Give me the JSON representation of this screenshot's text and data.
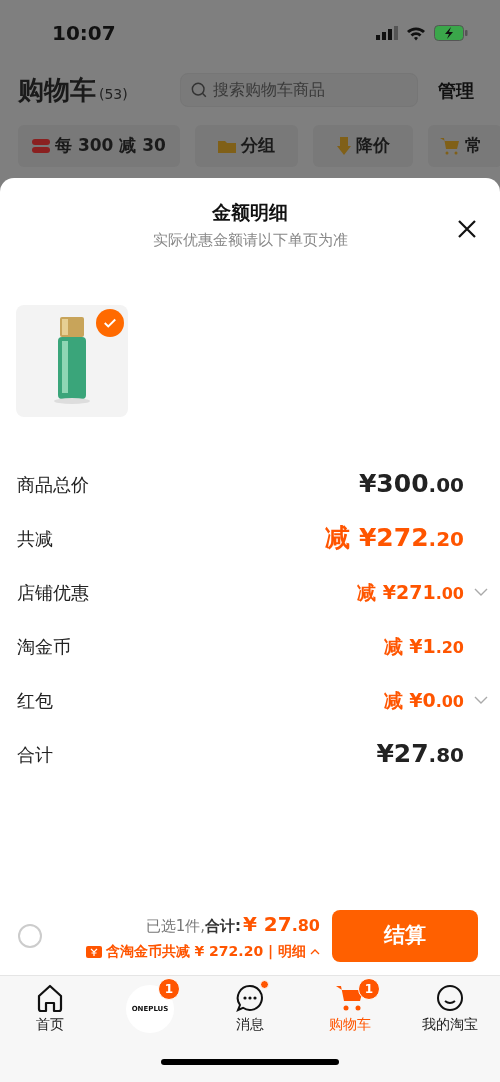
{
  "status_bar": {
    "time": "10:07"
  },
  "header": {
    "title": "购物车",
    "count": "(53)",
    "search": {
      "placeholder": "搜索购物车商品"
    },
    "action": "管理"
  },
  "chips": [
    {
      "label": "每 300 减 30",
      "kind": "coupon"
    },
    {
      "label": "分组",
      "kind": "folder"
    },
    {
      "label": "降价",
      "kind": "drop"
    },
    {
      "label": "常",
      "kind": "cart"
    }
  ],
  "sheet": {
    "title": "金额明细",
    "subtitle": "实际优惠金额请以下单页为准",
    "product": {
      "kind": "picture",
      "checked": true
    },
    "rows": [
      {
        "label": "商品总价",
        "amount": "¥300.00",
        "kind": "total",
        "expandable": false
      },
      {
        "label": "共减",
        "amount": "减 ¥272.20",
        "kind": "discount-main",
        "expandable": false
      },
      {
        "label": "店铺优惠",
        "amount": "减 ¥271.00",
        "kind": "discount",
        "expandable": true
      },
      {
        "label": "淘金币",
        "amount": "减 ¥1.20",
        "kind": "discount",
        "expandable": false
      },
      {
        "label": "红包",
        "amount": "减 ¥0.00",
        "kind": "discount",
        "expandable": true
      },
      {
        "label": "合计",
        "amount": "¥27.80",
        "kind": "total",
        "expandable": false
      }
    ]
  },
  "checkout": {
    "select_all": {
      "checked": false
    },
    "summary": "已选1件,",
    "total_label": "合计:",
    "amount": "¥ 27.80",
    "savings": "含淘金币共减 ¥ 272.20 | 明细",
    "details_expanded": true,
    "button": "结算"
  },
  "tabs": [
    {
      "label": "首页",
      "kind": "home",
      "selected": false
    },
    {
      "label": "ONEPLUS",
      "kind": "brand",
      "selected": false,
      "badge": "1"
    },
    {
      "label": "消息",
      "kind": "message",
      "selected": false,
      "dot": true
    },
    {
      "label": "购物车",
      "kind": "cart",
      "selected": true,
      "badge": "1"
    },
    {
      "label": "我的淘宝",
      "kind": "face",
      "selected": false
    }
  ]
}
